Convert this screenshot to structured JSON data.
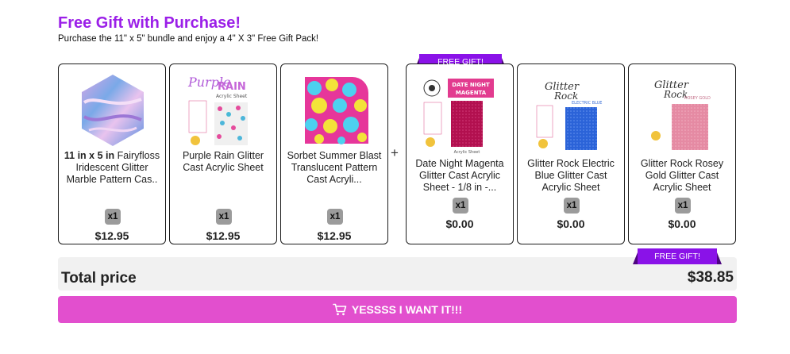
{
  "header": {
    "title": "Free Gift with Purchase!",
    "subtitle": "Purchase the 11\" x 5\" bundle and enjoy a 4\" X 3\" Free Gift Pack!"
  },
  "bundle_items": [
    {
      "name_bold": "11 in x 5 in",
      "name": "Fairyfloss Iridescent Glitter Marble Pattern Cas..",
      "qty": "x1",
      "price": "$12.95"
    },
    {
      "name": "Purple Rain Glitter Cast Acrylic Sheet",
      "qty": "x1",
      "price": "$12.95"
    },
    {
      "name": "Sorbet Summer Blast Translucent Pattern Cast Acryli...",
      "qty": "x1",
      "price": "$12.95"
    }
  ],
  "plus_sign": "+",
  "gift_items": [
    {
      "badge": "FREE GIFT!",
      "name": "Date Night Magenta Glitter Cast Acrylic Sheet - 1/8 in -...",
      "qty": "x1",
      "price": "$0.00"
    },
    {
      "name": "Glitter Rock Electric Blue Glitter Cast Acrylic Sheet",
      "qty": "x1",
      "price": "$0.00"
    },
    {
      "name": "Glitter Rock Rosey Gold Glitter Cast Acrylic Sheet",
      "qty": "x1",
      "price": "$0.00"
    }
  ],
  "total": {
    "badge": "FREE GIFT!",
    "label": "Total price",
    "value": "$38.85"
  },
  "cta": {
    "label": "YESSSS I WANT IT!!!",
    "icon": "cart-icon"
  },
  "colors": {
    "title": "#9b1fe8",
    "ribbon": "#8a12e8",
    "cta": "#e24fce",
    "total_bg": "#f1f1f1"
  },
  "thumb_text": {
    "purple_rain_word1": "Purple",
    "purple_rain_word2": "RAIN",
    "purple_rain_sub": "Acrylic Sheet",
    "date_night_1": "DATE NIGHT",
    "date_night_2": "MAGENTA",
    "date_night_sub": "Acrylic Sheet",
    "glitter_rock_1": "Glitter",
    "glitter_rock_2": "Rock",
    "electric_blue": "ELECTRIC BLUE",
    "rosey_gold": "ROSEY GOLD"
  }
}
